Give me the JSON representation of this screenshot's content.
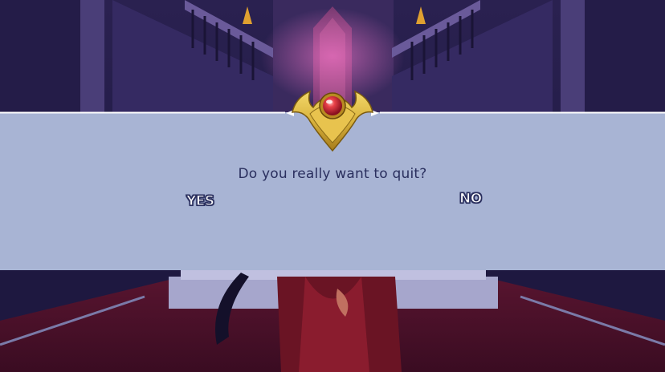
{
  "dialog": {
    "prompt": "Do you really want to quit?",
    "yes_label": "YES",
    "no_label": "NO"
  },
  "colors": {
    "panel": "#a8b4d4",
    "prompt_text": "#2a2f5e",
    "emblem_gold": "#d9b23c",
    "gem_red": "#d8303a"
  },
  "icons": {
    "emblem": "gold-winged-crest-icon",
    "gem": "red-gem-icon"
  }
}
